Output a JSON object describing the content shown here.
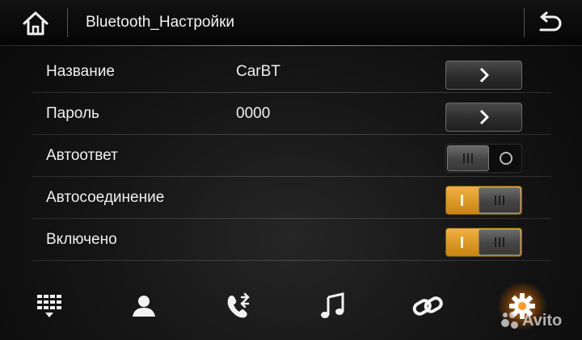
{
  "header": {
    "title": "Bluetooth_Настройки",
    "home_icon": "home-icon",
    "back_icon": "back-arrow-icon"
  },
  "settings": [
    {
      "label": "Название",
      "value": "CarBT",
      "control": "arrow"
    },
    {
      "label": "Пароль",
      "value": "0000",
      "control": "arrow"
    },
    {
      "label": "Автоответ",
      "value": "",
      "control": "toggle",
      "state": "off"
    },
    {
      "label": "Автосоединение",
      "value": "",
      "control": "toggle",
      "state": "on"
    },
    {
      "label": "Включено",
      "value": "",
      "control": "toggle",
      "state": "on"
    }
  ],
  "bottom_nav": [
    {
      "icon": "dialpad-icon",
      "active": false
    },
    {
      "icon": "contacts-icon",
      "active": false
    },
    {
      "icon": "call-log-icon",
      "active": false
    },
    {
      "icon": "music-icon",
      "active": false
    },
    {
      "icon": "link-icon",
      "active": false
    },
    {
      "icon": "settings-gear-icon",
      "active": true
    }
  ],
  "watermark": {
    "text": "Avito"
  },
  "colors": {
    "toggle_on": "#e09a2a",
    "active_glow": "#ff9a28"
  }
}
